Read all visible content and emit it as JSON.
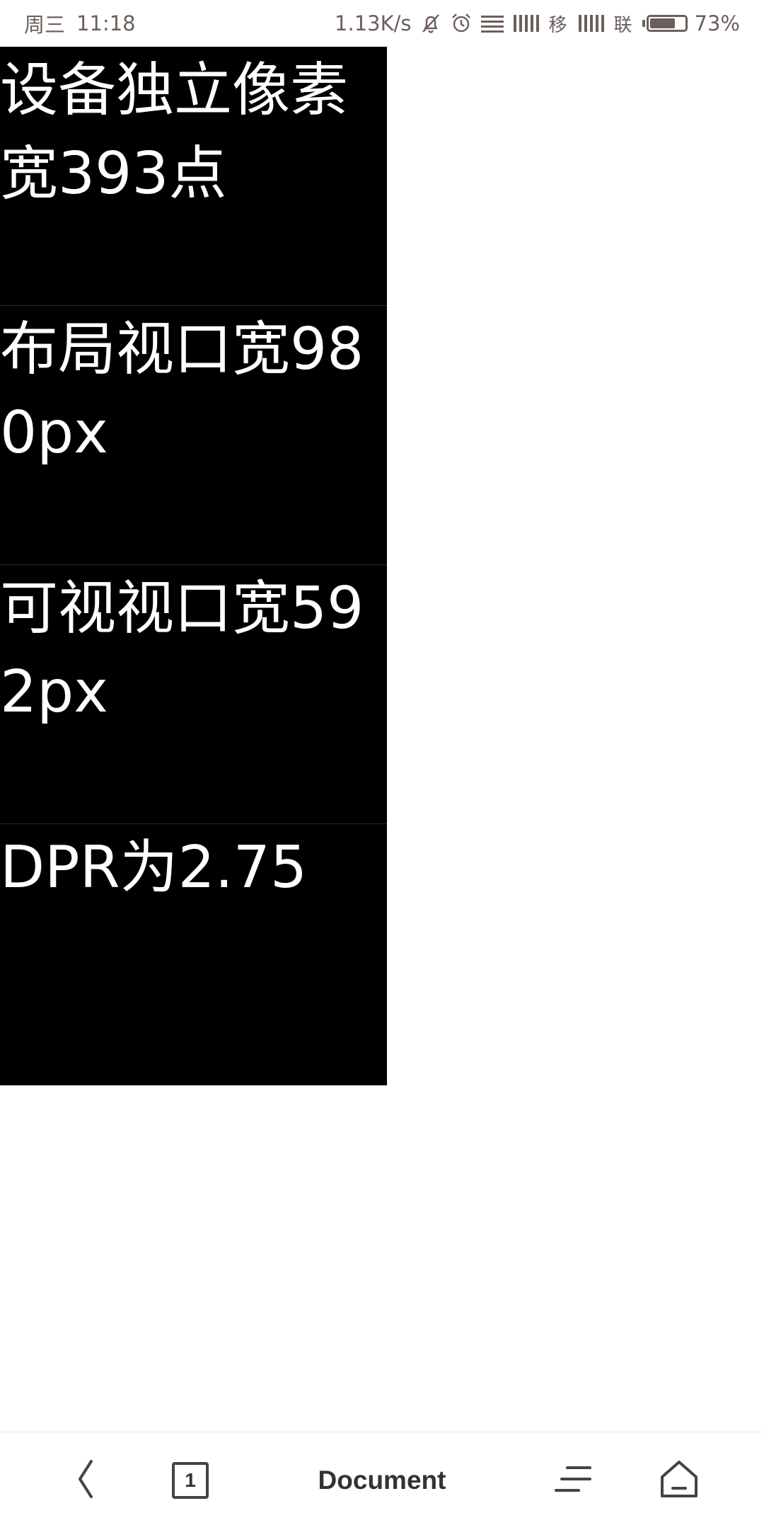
{
  "status_bar": {
    "weekday": "周三",
    "time": "11:18",
    "net_speed": "1.13K/s",
    "carrier_1": "移",
    "carrier_2": "联",
    "battery_text": "73%",
    "battery_level": 0.73,
    "icons": [
      "mute-icon",
      "alarm-icon",
      "data-lines-icon",
      "signal-icon",
      "signal-icon"
    ],
    "color": "#6b5f5b"
  },
  "content": {
    "background": "#000000",
    "text_color": "#ffffff",
    "cells": [
      {
        "text": "设备独立像素宽393点"
      },
      {
        "text": "布局视口宽980px"
      },
      {
        "text": "可视视口宽592px"
      },
      {
        "text": "DPR为2.75"
      }
    ]
  },
  "bottom_bar": {
    "title": "Document",
    "tab_count": "1",
    "icons": [
      "back-icon",
      "tabs-icon",
      "menu-icon",
      "home-icon"
    ]
  }
}
